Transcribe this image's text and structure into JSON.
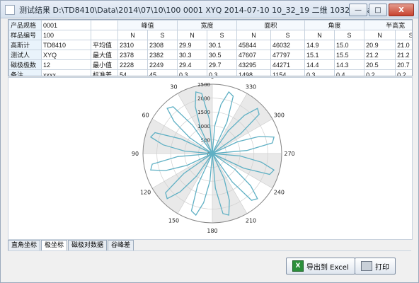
{
  "window": {
    "title": "测试结果   D:\\TD8410\\Data\\2014\\07\\10\\100 0001 XYQ 2014-07-10 10_32_19 二维 103254.dat",
    "buttons": {
      "minimize": "—",
      "maximize": "□",
      "close": "X"
    }
  },
  "summary": {
    "labels": [
      "产品规格",
      "样品编号",
      "高斯计",
      "测试人",
      "磁极极数",
      "备注"
    ],
    "values": [
      "0001",
      "100",
      "TD8410",
      "XYQ",
      "12",
      "xxxx"
    ]
  },
  "stats": {
    "groups": [
      "峰值",
      "宽度",
      "面积",
      "角度",
      "半高宽"
    ],
    "ns": [
      "N",
      "S"
    ],
    "row_labels": [
      "平均值",
      "最大值",
      "最小值",
      "标准差"
    ],
    "rows": [
      [
        "2310",
        "2308",
        "29.9",
        "30.1",
        "45844",
        "46032",
        "14.9",
        "15.0",
        "20.9",
        "21.0"
      ],
      [
        "2378",
        "2382",
        "30.3",
        "30.5",
        "47607",
        "47797",
        "15.1",
        "15.5",
        "21.2",
        "21.2"
      ],
      [
        "2228",
        "2249",
        "29.4",
        "29.7",
        "43295",
        "44271",
        "14.4",
        "14.3",
        "20.5",
        "20.7"
      ],
      [
        "54",
        "45",
        "0.3",
        "0.3",
        "1498",
        "1154",
        "0.3",
        "0.4",
        "0.2",
        "0.2"
      ]
    ]
  },
  "chart_data": {
    "type": "polar",
    "radial_ticks": [
      0,
      500,
      1000,
      1500,
      2000,
      2500
    ],
    "angle_ticks": [
      0,
      30,
      60,
      90,
      120,
      150,
      180,
      210,
      240,
      270,
      300,
      330
    ],
    "series": [
      {
        "name": "",
        "x": [
          0,
          5,
          10,
          15,
          20,
          25,
          30,
          35,
          40,
          45,
          50,
          55,
          60,
          65,
          70,
          75,
          80,
          85,
          90,
          95,
          100,
          105,
          110,
          115,
          120,
          125,
          130,
          135,
          140,
          145,
          150,
          155,
          160,
          165,
          170,
          175,
          180,
          185,
          190,
          195,
          200,
          205,
          210,
          215,
          220,
          225,
          230,
          235,
          240,
          245,
          250,
          255,
          260,
          265,
          270,
          275,
          280,
          285,
          290,
          295,
          300,
          305,
          310,
          315,
          320,
          325,
          330,
          335,
          340,
          345,
          350,
          355,
          360
        ],
        "y": [
          0,
          1250,
          2200,
          2300,
          1800,
          1000,
          0,
          1250,
          2200,
          2300,
          1800,
          1000,
          0,
          1250,
          2200,
          2300,
          1800,
          1000,
          0,
          1250,
          2200,
          2300,
          1800,
          1000,
          0,
          1250,
          2200,
          2300,
          1800,
          1000,
          0,
          1250,
          2200,
          2300,
          1800,
          1000,
          0,
          1250,
          2200,
          2300,
          1800,
          1000,
          0,
          1250,
          2200,
          2300,
          1800,
          1000,
          0,
          1250,
          2200,
          2300,
          1800,
          1000,
          0,
          1250,
          2200,
          2300,
          1800,
          1000,
          0,
          1250,
          2200,
          2300,
          1800,
          1000,
          0,
          1250,
          2200,
          2300,
          1800,
          1000,
          0
        ]
      }
    ]
  },
  "tabs": [
    "直角坐标",
    "极坐标",
    "磁极对数据",
    "谷峰差"
  ],
  "actions": {
    "export": "导出到 Excel",
    "print": "打印"
  }
}
